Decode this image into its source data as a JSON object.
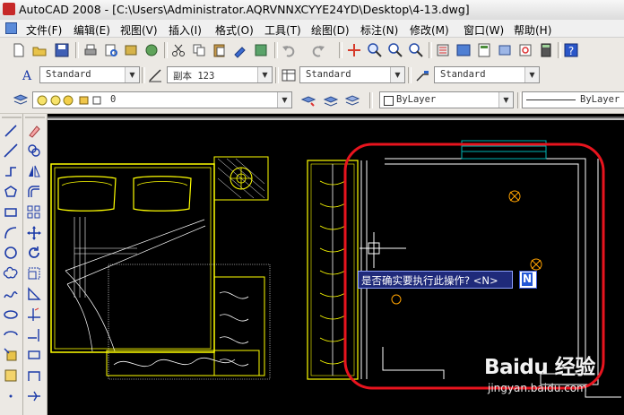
{
  "window": {
    "title": "AutoCAD 2008 - [C:\\Users\\Administrator.AQRVNNXCYYE24YD\\Desktop\\4-13.dwg]"
  },
  "menu": [
    "文件(F)",
    "编辑(E)",
    "视图(V)",
    "插入(I)",
    "格式(O)",
    "工具(T)",
    "绘图(D)",
    "标注(N)",
    "修改(M)",
    "窗口(W)",
    "帮助(H)"
  ],
  "styles": {
    "text_style": "Standard",
    "dim_style": "副本 123",
    "table_style": "Standard",
    "multileader_style": "Standard"
  },
  "layers": {
    "current_layer": "0"
  },
  "properties": {
    "color": "ByLayer",
    "linetype": "ByLayer"
  },
  "command_prompt": {
    "message": "是否确实要执行此操作? <N>",
    "input_value": "N"
  },
  "watermark": {
    "brand": "Baidu 经验",
    "url": "jingyan.baidu.com"
  },
  "colors": {
    "highlight_circle": "#e8141e",
    "drawing_line": "#ffff00",
    "wall_line": "#ffffff",
    "prompt_bg": "#1f2a7a",
    "window_frame": "#00b4b4"
  }
}
